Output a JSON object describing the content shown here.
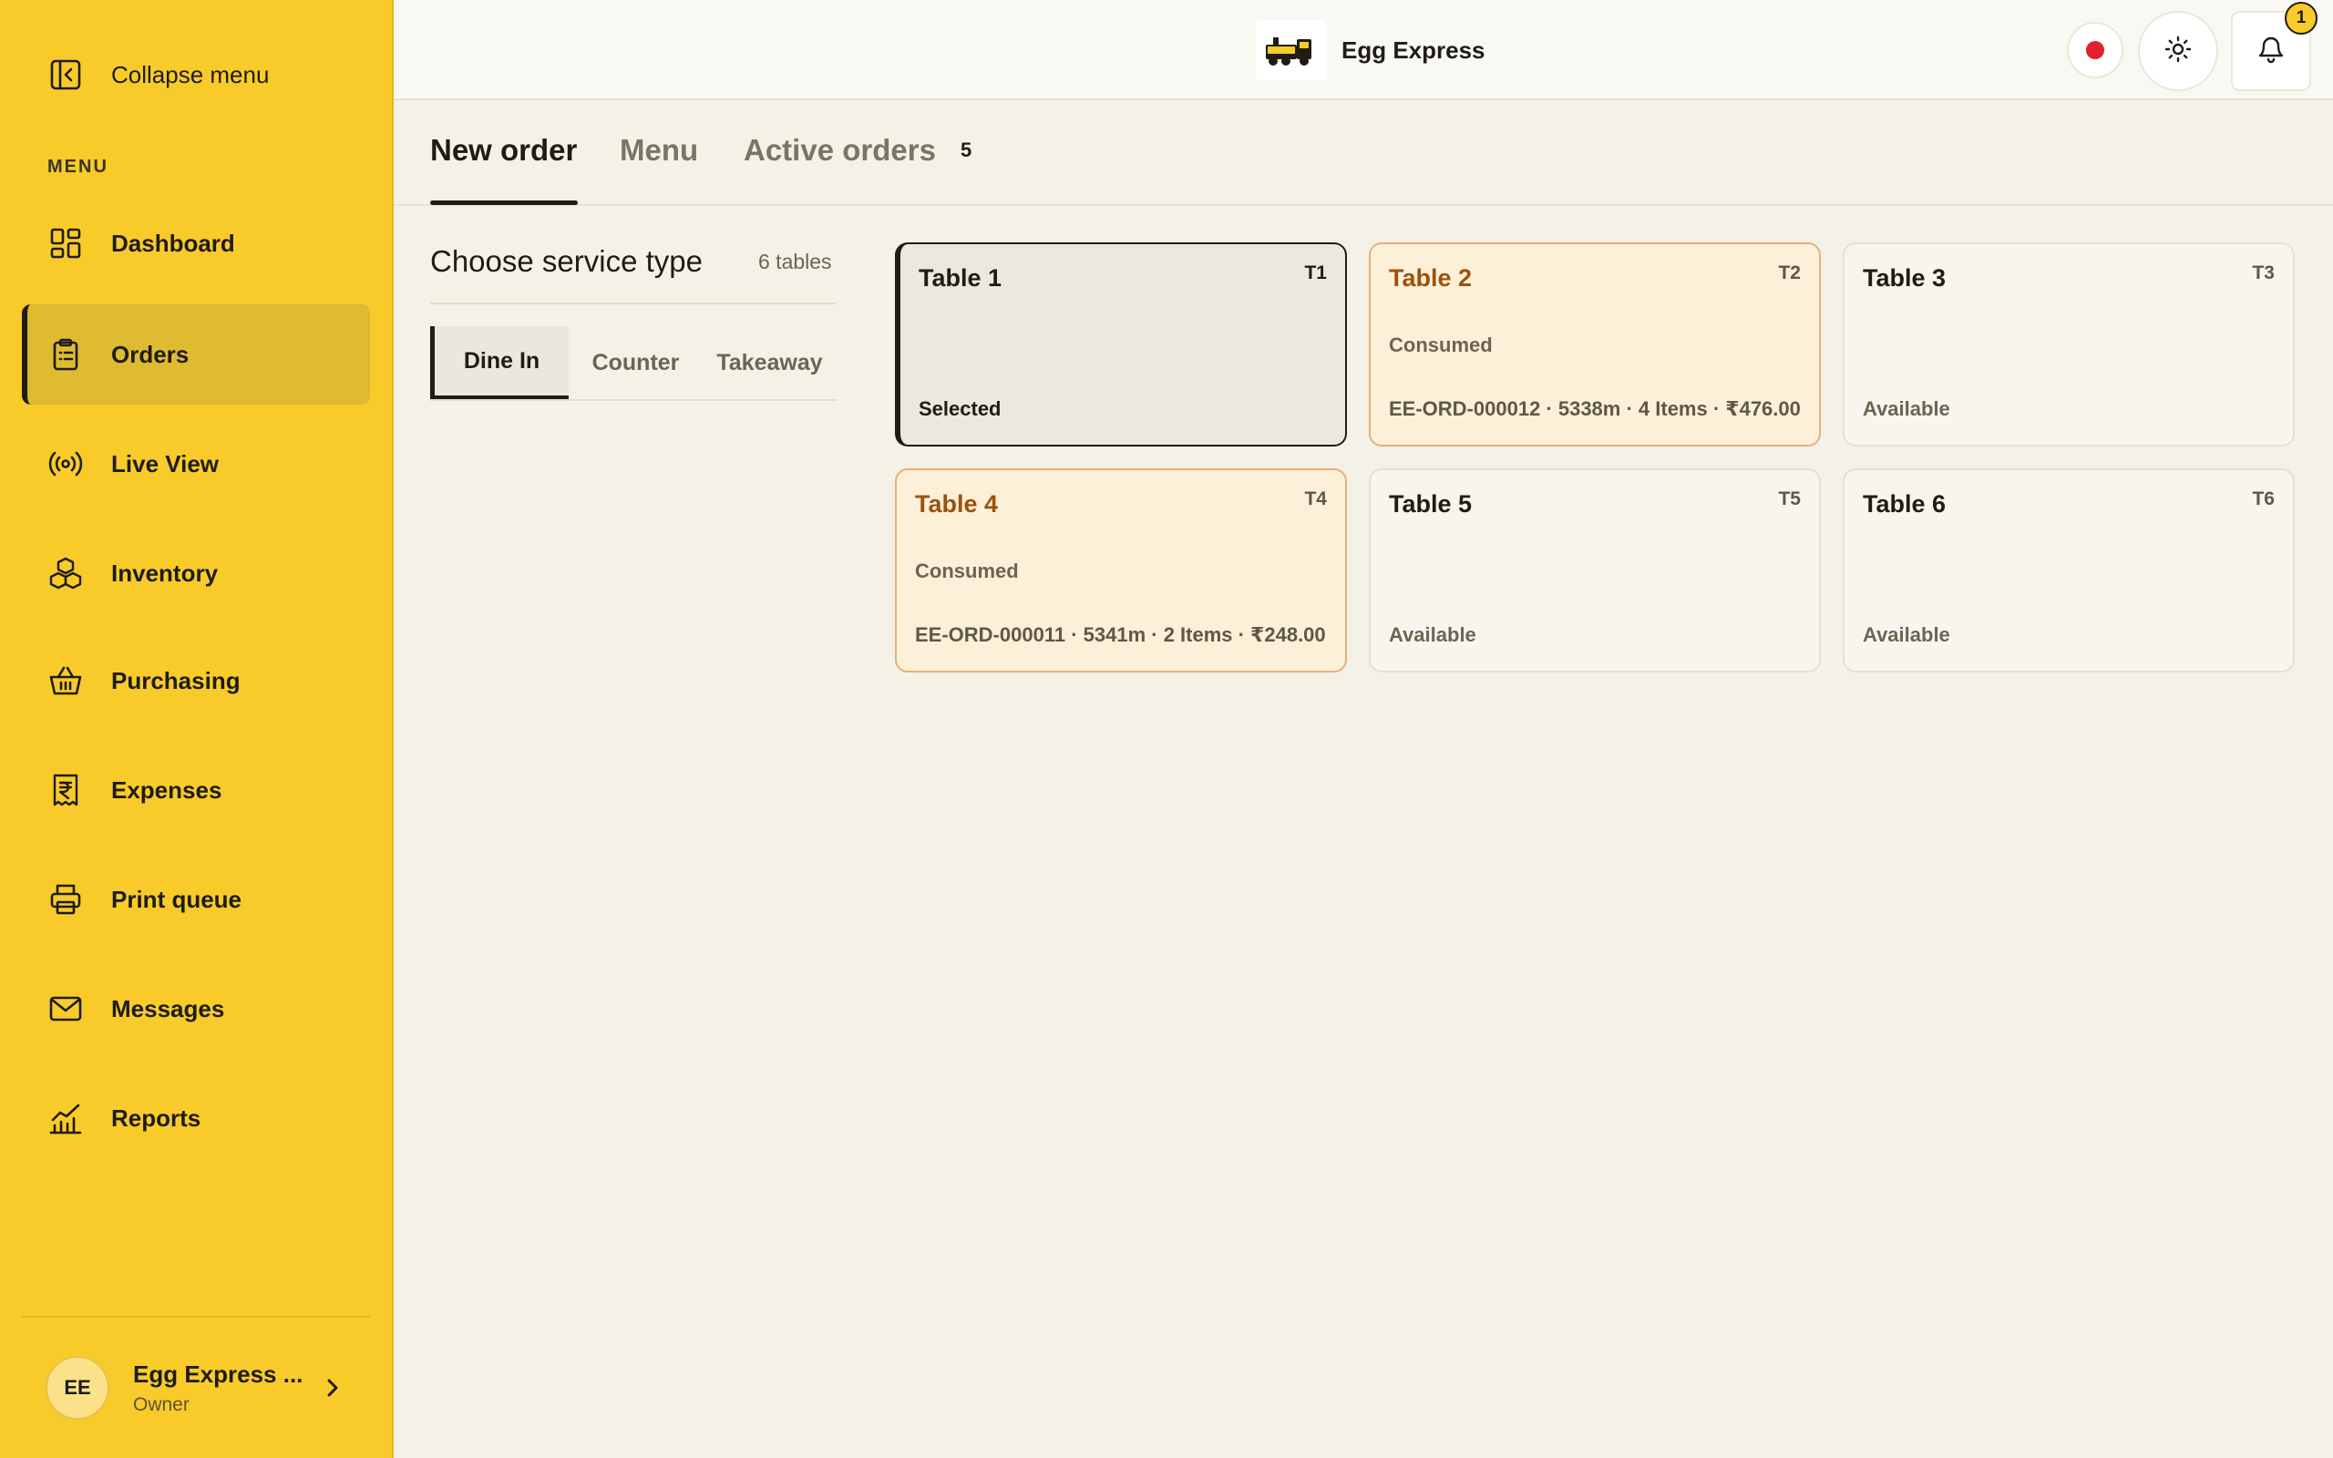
{
  "app": {
    "brand_name": "Egg Express",
    "accent_color": "#f8cb2b",
    "recording_color": "#e3202f"
  },
  "sidebar": {
    "collapse_label": "Collapse menu",
    "menu_heading": "MENU",
    "items": [
      {
        "label": "Dashboard",
        "icon": "dashboard-icon",
        "active": false
      },
      {
        "label": "Orders",
        "icon": "clipboard-icon",
        "active": true
      },
      {
        "label": "Live View",
        "icon": "broadcast-icon",
        "active": false
      },
      {
        "label": "Inventory",
        "icon": "boxes-icon",
        "active": false
      },
      {
        "label": "Purchasing",
        "icon": "basket-icon",
        "active": false
      },
      {
        "label": "Expenses",
        "icon": "rupee-receipt-icon",
        "active": false
      },
      {
        "label": "Print queue",
        "icon": "printer-icon",
        "active": false
      },
      {
        "label": "Messages",
        "icon": "mail-icon",
        "active": false
      },
      {
        "label": "Reports",
        "icon": "chart-icon",
        "active": false
      }
    ],
    "profile": {
      "initials": "EE",
      "name": "Egg Express ...",
      "role": "Owner"
    }
  },
  "topbar": {
    "notification_count": "1"
  },
  "tabs": [
    {
      "label": "New order",
      "active": true
    },
    {
      "label": "Menu",
      "active": false
    },
    {
      "label": "Active orders",
      "active": false,
      "count": "5"
    }
  ],
  "service": {
    "title": "Choose service type",
    "table_count": "6 tables",
    "options": [
      {
        "label": "Dine In",
        "active": true
      },
      {
        "label": "Counter",
        "active": false
      },
      {
        "label": "Takeaway",
        "active": false
      }
    ]
  },
  "tables": [
    {
      "name": "Table 1",
      "code": "T1",
      "status": "Selected",
      "state": "selected",
      "meta": ""
    },
    {
      "name": "Table 2",
      "code": "T2",
      "status": "Consumed",
      "state": "consumed",
      "meta": "EE-ORD-000012 · 5338m · 4 Items · ₹476.00"
    },
    {
      "name": "Table 3",
      "code": "T3",
      "status": "Available",
      "state": "available",
      "meta": ""
    },
    {
      "name": "Table 4",
      "code": "T4",
      "status": "Consumed",
      "state": "consumed",
      "meta": "EE-ORD-000011 · 5341m · 2 Items · ₹248.00"
    },
    {
      "name": "Table 5",
      "code": "T5",
      "status": "Available",
      "state": "available",
      "meta": ""
    },
    {
      "name": "Table 6",
      "code": "T6",
      "status": "Available",
      "state": "available",
      "meta": ""
    }
  ]
}
